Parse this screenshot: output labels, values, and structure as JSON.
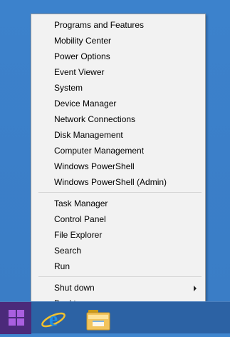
{
  "context_menu": {
    "group1": [
      {
        "label": "Programs and Features"
      },
      {
        "label": "Mobility Center"
      },
      {
        "label": "Power Options"
      },
      {
        "label": "Event Viewer"
      },
      {
        "label": "System"
      },
      {
        "label": "Device Manager"
      },
      {
        "label": "Network Connections"
      },
      {
        "label": "Disk Management"
      },
      {
        "label": "Computer Management"
      },
      {
        "label": "Windows PowerShell"
      },
      {
        "label": "Windows PowerShell (Admin)"
      }
    ],
    "group2": [
      {
        "label": "Task Manager"
      },
      {
        "label": "Control Panel"
      },
      {
        "label": "File Explorer"
      },
      {
        "label": "Search"
      },
      {
        "label": "Run"
      }
    ],
    "group3": [
      {
        "label": "Shut down",
        "has_submenu": true
      },
      {
        "label": "Desktop"
      }
    ]
  },
  "taskbar": {
    "icons": [
      "windows-start-icon",
      "internet-explorer-icon",
      "file-explorer-icon"
    ],
    "colors": {
      "start_button": "#4b2a7a",
      "taskbar": "#2c62a4",
      "desktop": "#3c82cc"
    }
  }
}
